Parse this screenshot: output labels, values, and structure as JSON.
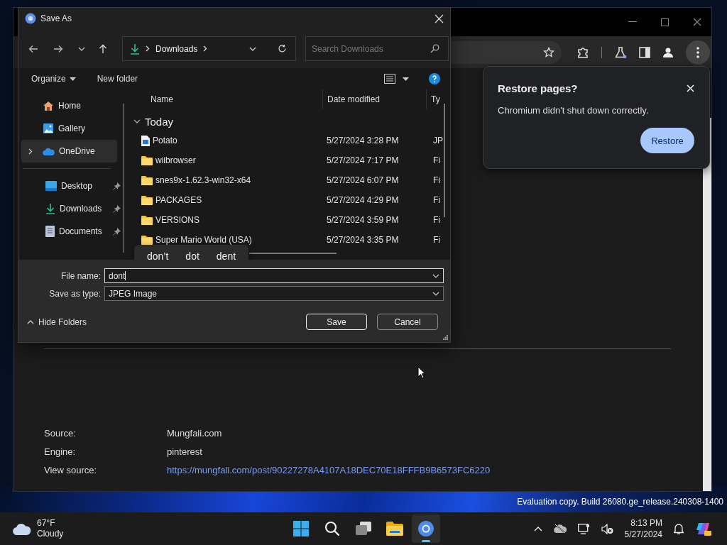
{
  "dialog": {
    "title": "Save As",
    "address": {
      "crumb": "Downloads"
    },
    "search": {
      "placeholder": "Search Downloads"
    },
    "toolbar": {
      "organize": "Organize",
      "new_folder": "New folder"
    },
    "sidebar": {
      "nav": [
        {
          "label": "Home",
          "kind": "home",
          "expandable": false,
          "selected": false
        },
        {
          "label": "Gallery",
          "kind": "gallery",
          "expandable": false,
          "selected": false
        },
        {
          "label": "OneDrive",
          "kind": "cloud",
          "expandable": true,
          "selected": true
        }
      ],
      "quick_access": [
        {
          "label": "Desktop",
          "kind": "desktop",
          "pinned": true
        },
        {
          "label": "Downloads",
          "kind": "download",
          "pinned": true
        },
        {
          "label": "Documents",
          "kind": "document",
          "pinned": true
        }
      ]
    },
    "columns": [
      "Name",
      "Date modified",
      "Ty"
    ],
    "group": {
      "label": "Today",
      "expanded": true
    },
    "rows": [
      {
        "name": "Potato",
        "kind": "image",
        "date": "5/27/2024 3:28 PM",
        "column_3": "JP"
      },
      {
        "name": "wiibrowser",
        "kind": "folder",
        "date": "5/27/2024 7:17 PM",
        "column_3": "Fi"
      },
      {
        "name": "snes9x-1.62.3-win32-x64",
        "kind": "folder",
        "date": "5/27/2024 6:07 PM",
        "column_3": "Fi"
      },
      {
        "name": "PACKAGES",
        "kind": "folder",
        "date": "5/27/2024 4:29 PM",
        "column_3": "Fi"
      },
      {
        "name": "VERSIONS",
        "kind": "folder",
        "date": "5/27/2024 3:59 PM",
        "column_3": "Fi"
      },
      {
        "name": "Super Mario World (USA)",
        "kind": "folder",
        "date": "5/27/2024 3:35 PM",
        "column_3": "Fi"
      }
    ],
    "suggestions": [
      "don’t",
      "dot",
      "dent"
    ],
    "file_name": {
      "label": "File name:",
      "value": "dont"
    },
    "save_type": {
      "label": "Save as type:",
      "value": "JPEG Image"
    },
    "hide_folders": "Hide Folders",
    "buttons": [
      {
        "label": "Save",
        "kind": "primary"
      },
      {
        "label": "Cancel",
        "kind": "secondary"
      }
    ]
  },
  "restore_popup": {
    "title": "Restore pages?",
    "message": "Chromium didn't shut down correctly.",
    "button": "Restore"
  },
  "page": {
    "details": [
      {
        "label": "Source:",
        "value": "Mungfali.com",
        "kind": "text"
      },
      {
        "label": "Engine:",
        "value": "pinterest",
        "kind": "text"
      },
      {
        "label": "View source:",
        "value": "https://mungfali.com/post/90227278A4107A18DEC70E18FFFB9B6573FC6220",
        "kind": "link"
      }
    ]
  },
  "os_notice": "Evaluation copy. Build 26080.ge_release.240308-1400",
  "taskbar": {
    "weather": {
      "temperature": "67°F",
      "condition": "Cloudy"
    },
    "apps": [
      {
        "kind": "start",
        "selected": false
      },
      {
        "kind": "search",
        "selected": false
      },
      {
        "kind": "taskview",
        "selected": false
      },
      {
        "kind": "explorer",
        "selected": false
      },
      {
        "kind": "browser",
        "selected": true
      }
    ],
    "clock": {
      "time": "8:13 PM",
      "date": "5/27/2024"
    }
  }
}
